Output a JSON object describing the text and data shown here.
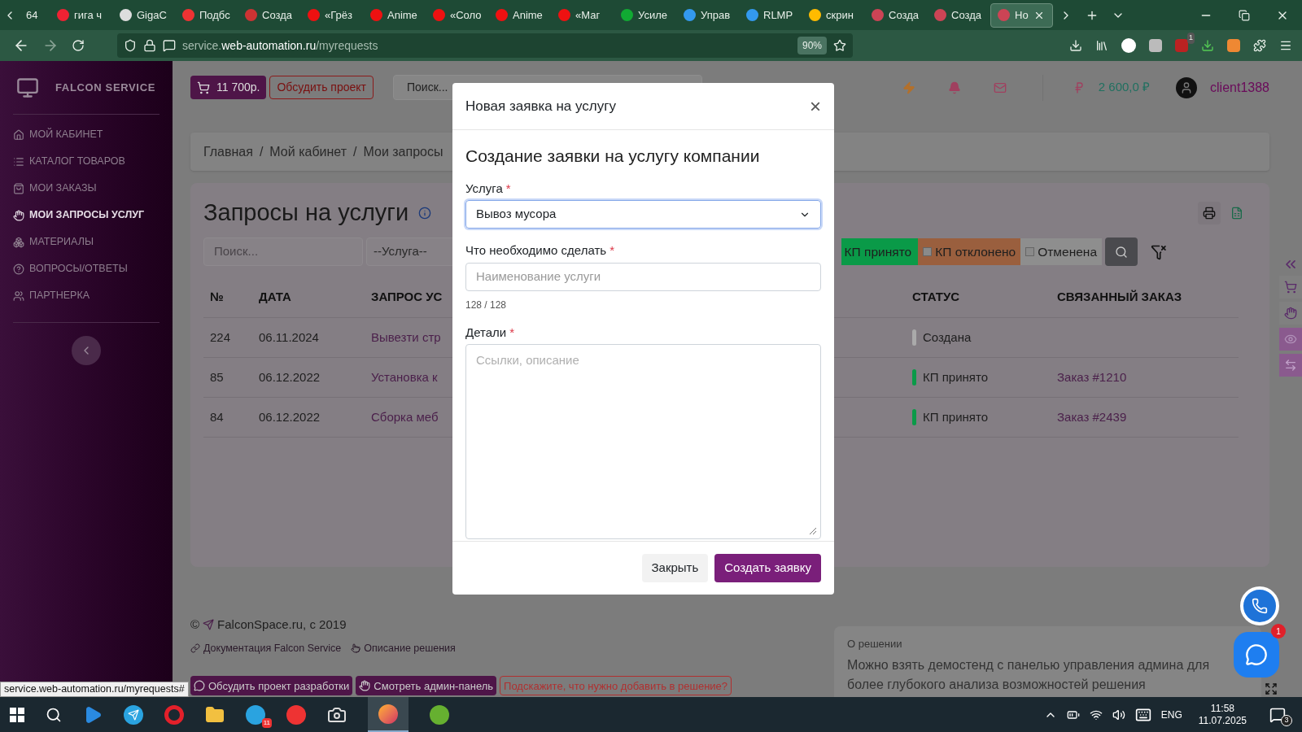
{
  "browser": {
    "tabs": [
      {
        "label": "64",
        "selected": false
      },
      {
        "label": "гига ч",
        "selected": false
      },
      {
        "label": "GigaC",
        "selected": false
      },
      {
        "label": "Подбс",
        "selected": false
      },
      {
        "label": "Созда",
        "selected": false
      },
      {
        "label": "«Грёз",
        "selected": false
      },
      {
        "label": "Anime",
        "selected": false
      },
      {
        "label": "«Соло",
        "selected": false
      },
      {
        "label": "Anime",
        "selected": false
      },
      {
        "label": "«Маг",
        "selected": false
      },
      {
        "label": "Усиле",
        "selected": false
      },
      {
        "label": "Управ",
        "selected": false
      },
      {
        "label": "RLMP",
        "selected": false
      },
      {
        "label": "скрин",
        "selected": false
      },
      {
        "label": "Созда",
        "selected": false
      },
      {
        "label": "Созда",
        "selected": false
      },
      {
        "label": "Но",
        "selected": true
      }
    ],
    "url_prefix": "service.",
    "url_domain": "web-automation.ru",
    "url_path": "/myrequests",
    "zoom": "90%",
    "extension_badge": "1"
  },
  "sidebar": {
    "brand": "FALCON SERVICE",
    "items": [
      {
        "label": "МОЙ КАБИНЕТ",
        "selected": false
      },
      {
        "label": "КАТАЛОГ ТОВАРОВ",
        "selected": false
      },
      {
        "label": "МОИ ЗАКАЗЫ",
        "selected": false
      },
      {
        "label": "МОИ ЗАПРОСЫ УСЛУГ",
        "selected": true
      },
      {
        "label": "МАТЕРИАЛЫ",
        "selected": false
      },
      {
        "label": "ВОПРОСЫ/ОТВЕТЫ",
        "selected": false
      },
      {
        "label": "ПАРТНЕРКА",
        "selected": false
      }
    ]
  },
  "header": {
    "cart": "11 700р.",
    "discuss": "Обсудить проект",
    "search_placeholder": "Поиск...",
    "balance": "2 600,0 ₽",
    "user": "client1388"
  },
  "breadcrumb": {
    "items": [
      "Главная",
      "Мой кабинет",
      "Мои запросы"
    ],
    "separator": "/"
  },
  "page": {
    "title": "Запросы на услуги",
    "search_placeholder": "Поиск...",
    "service_filter": "--Услуга--",
    "status_filters": [
      {
        "label": "КП принято",
        "color": "#0a9a48"
      },
      {
        "label": "КП отклонено",
        "color": "#9a5f3e",
        "checked": false
      },
      {
        "label": "Отменена",
        "color": "#8e8e8e",
        "checked": false
      }
    ]
  },
  "table": {
    "columns": [
      "№",
      "ДАТА",
      "ЗАПРОС УС",
      "СТАТУС",
      "СВЯЗАННЫЙ ЗАКАЗ"
    ],
    "rows": [
      {
        "number": "224",
        "date": "06.11.2024",
        "request": "Вывезти стр",
        "status": "Создана",
        "color": "#aaaaaa"
      },
      {
        "number": "85",
        "date": "06.12.2022",
        "request": "Установка к",
        "status": "КП принято",
        "color": "#0a9a48",
        "order": "Заказ #1210"
      },
      {
        "number": "84",
        "date": "06.12.2022",
        "request": "Сборка меб",
        "status": "КП принято",
        "color": "#0a9a48",
        "order": "Заказ #2439"
      }
    ]
  },
  "footer": {
    "copyright": "© ",
    "site": "FalconSpace.ru, с 2019",
    "links": [
      "Документация Falcon Service",
      "Описание решения"
    ],
    "buttons": [
      "Обсудить проект разработки",
      "Смотреть админ-панель",
      "Подскажите, что нужно добавить в решение?"
    ],
    "about_title": "О решении",
    "about_text": "Можно взять демостенд с панелью управления админа для более глубокого анализа возможностей решения",
    "chat_badge": "1"
  },
  "modal": {
    "title": "Новая заявка на услугу",
    "close": "×",
    "heading": "Создание заявки на услугу компании",
    "service_label": "Услуга",
    "service_value": "Вывоз мусора",
    "task_label": "Что необходимо сделать",
    "task_placeholder": "Наименование услуги",
    "counter": "128 / 128",
    "details_label": "Детали",
    "details_placeholder": "Ссылки, описание",
    "required": "*",
    "cancel": "Закрыть",
    "submit": "Создать заявку"
  },
  "status_url": "service.web-automation.ru/myrequests#",
  "taskbar": {
    "telegram_badge": "11",
    "language": "ENG",
    "time": "11:58",
    "date": "11.07.2025",
    "notifications": "3"
  }
}
